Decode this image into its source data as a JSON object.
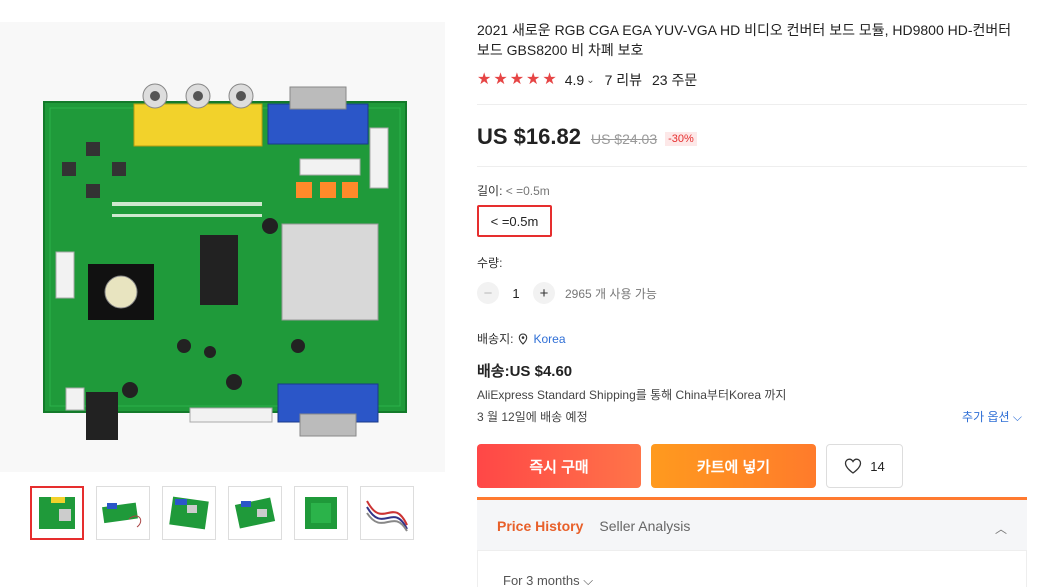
{
  "product": {
    "title": "2021 새로운 RGB CGA EGA YUV-VGA HD 비디오 컨버터 보드 모듈, HD9800 HD-컨버터 보드 GBS8200 비 차폐 보호",
    "rating": "4.9",
    "reviews": "7 리뷰",
    "orders": "23 주문",
    "price": "US $16.82",
    "old_price": "US $24.03",
    "discount": "-30%"
  },
  "options": {
    "length_label": "길이:",
    "length_value": "< =0.5m",
    "length_option": "< =0.5m"
  },
  "quantity": {
    "label": "수량:",
    "minus": "−",
    "plus": "+",
    "value": "1",
    "available": "2965 개 사용 가능"
  },
  "shipping": {
    "ship_to_label": "배송지:",
    "location": "Korea",
    "price": "배송:US $4.60",
    "method": "AliExpress Standard Shipping를 통해 China부터Korea 까지",
    "delivery": "3 월 12일에 배송 예정",
    "more_options": "추가 옵션"
  },
  "actions": {
    "buy_now": "즉시 구매",
    "add_to_cart": "카트에 넣기",
    "wishlist_count": "14"
  },
  "panel": {
    "tab_price_history": "Price History",
    "tab_seller_analysis": "Seller Analysis",
    "period": "For 3 months"
  },
  "colors": {
    "accent_red": "#e62e2e",
    "buy_gradient": "#ff4747",
    "cart_gradient": "#ff9a1e",
    "panel_accent": "#ff7a30",
    "link_blue": "#2f6fd6"
  },
  "icons": [
    "star-icon",
    "chevron-down-icon",
    "location-pin-icon",
    "heart-icon",
    "chevron-up-icon"
  ]
}
